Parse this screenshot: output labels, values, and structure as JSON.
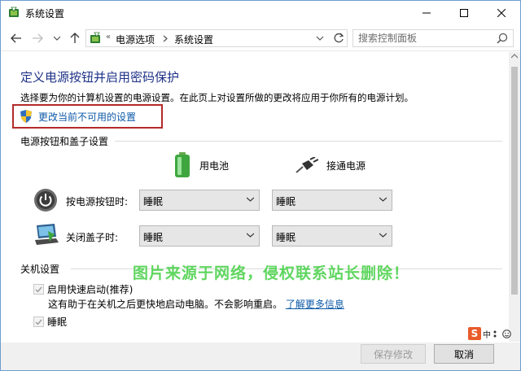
{
  "window": {
    "title": "系统设置"
  },
  "address": {
    "separators": "«",
    "crumbs": [
      "电源选项",
      "系统设置"
    ]
  },
  "search": {
    "placeholder": "搜索控制面板"
  },
  "content": {
    "heading": "定义电源按钮并启用密码保护",
    "description": "选择要为你的计算机设置的电源设置。在此页上对设置所做的更改将应用于你所有的电源计划。",
    "admin_link": "更改当前不可用的设置"
  },
  "power_section": {
    "title": "电源按钮和盖子设置",
    "col_battery": "用电池",
    "col_plugged": "接通电源",
    "rows": [
      {
        "label": "按电源按钮时:",
        "battery": "睡眠",
        "plugged": "睡眠"
      },
      {
        "label": "关闭盖子时:",
        "battery": "睡眠",
        "plugged": "睡眠"
      }
    ]
  },
  "shutdown_section": {
    "title": "关机设置",
    "fast_startup": "启用快速启动(推荐)",
    "fast_startup_desc": "这有助于在关机之后更快地启动电脑。不会影响重启。",
    "learn_more": "了解更多信息",
    "sleep": "睡眠"
  },
  "watermark": "图片来源于网络，侵权联系站长删除！",
  "ime": {
    "logo": "S",
    "lang": "中"
  },
  "footer": {
    "save": "保存修改",
    "cancel": "取消"
  }
}
